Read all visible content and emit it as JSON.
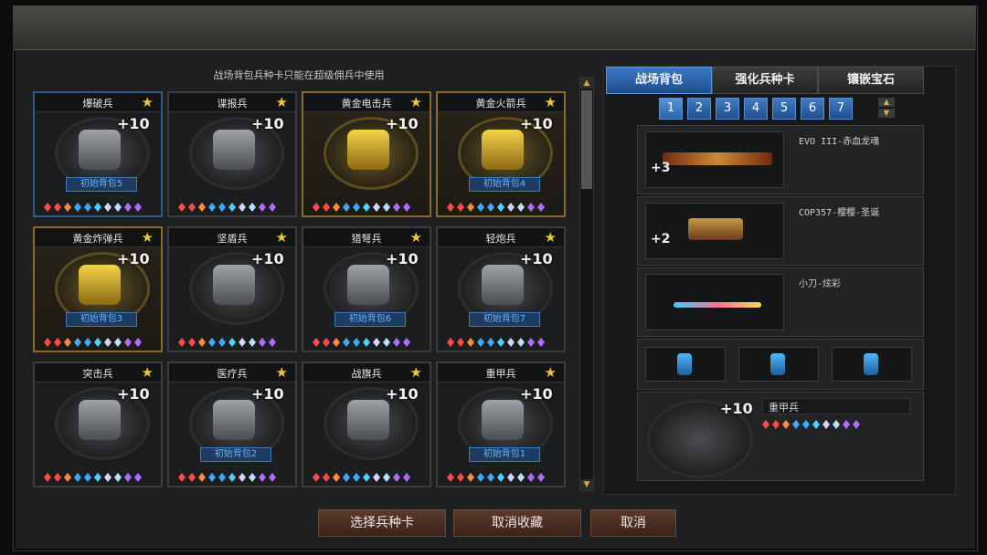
{
  "left": {
    "notice": "战场背包兵种卡只能在超级佣兵中使用",
    "cards": [
      {
        "name": "爆破兵",
        "plus": "+10",
        "bag": "初始背包5",
        "tier": "blue"
      },
      {
        "name": "谍报兵",
        "plus": "+10",
        "bag": "",
        "tier": "normal"
      },
      {
        "name": "黄金电击兵",
        "plus": "+10",
        "bag": "",
        "tier": "gold"
      },
      {
        "name": "黄金火箭兵",
        "plus": "+10",
        "bag": "初始背包4",
        "tier": "gold"
      },
      {
        "name": "黄金炸弹兵",
        "plus": "+10",
        "bag": "初始背包3",
        "tier": "gold"
      },
      {
        "name": "坚盾兵",
        "plus": "+10",
        "bag": "",
        "tier": "normal"
      },
      {
        "name": "猎弩兵",
        "plus": "+10",
        "bag": "初始背包6",
        "tier": "normal"
      },
      {
        "name": "轻炮兵",
        "plus": "+10",
        "bag": "初始背包7",
        "tier": "normal"
      },
      {
        "name": "突击兵",
        "plus": "+10",
        "bag": "",
        "tier": "normal"
      },
      {
        "name": "医疗兵",
        "plus": "+10",
        "bag": "初始背包2",
        "tier": "normal"
      },
      {
        "name": "战旗兵",
        "plus": "+10",
        "bag": "",
        "tier": "normal"
      },
      {
        "name": "重甲兵",
        "plus": "+10",
        "bag": "初始背包1",
        "tier": "normal"
      }
    ]
  },
  "right": {
    "tabs": [
      "战场背包",
      "强化兵种卡",
      "镶嵌宝石"
    ],
    "pages": [
      "1",
      "2",
      "3",
      "4",
      "5",
      "6",
      "7"
    ],
    "weapons": [
      {
        "name": "EVO III-赤血龙魂",
        "ammo": "+3"
      },
      {
        "name": "COP357-樱樱-圣诞",
        "ammo": "+2"
      },
      {
        "name": "小刀-炫彩",
        "ammo": ""
      }
    ],
    "unit": {
      "name": "重甲兵",
      "plus": "+10"
    }
  },
  "buttons": {
    "select": "选择兵种卡",
    "cancel_fav": "取消收藏",
    "cancel": "取消"
  },
  "gem_colors": [
    "#ff4a4a",
    "#ff4a4a",
    "#ff8a3d",
    "#3da9ff",
    "#3da9ff",
    "#4ad3ff",
    "#d4d4ff",
    "#b7e1ff",
    "#b06bff",
    "#b06bff"
  ],
  "theme": {
    "blue_accent": "#3d78c5",
    "gold": "#f0c53a"
  }
}
